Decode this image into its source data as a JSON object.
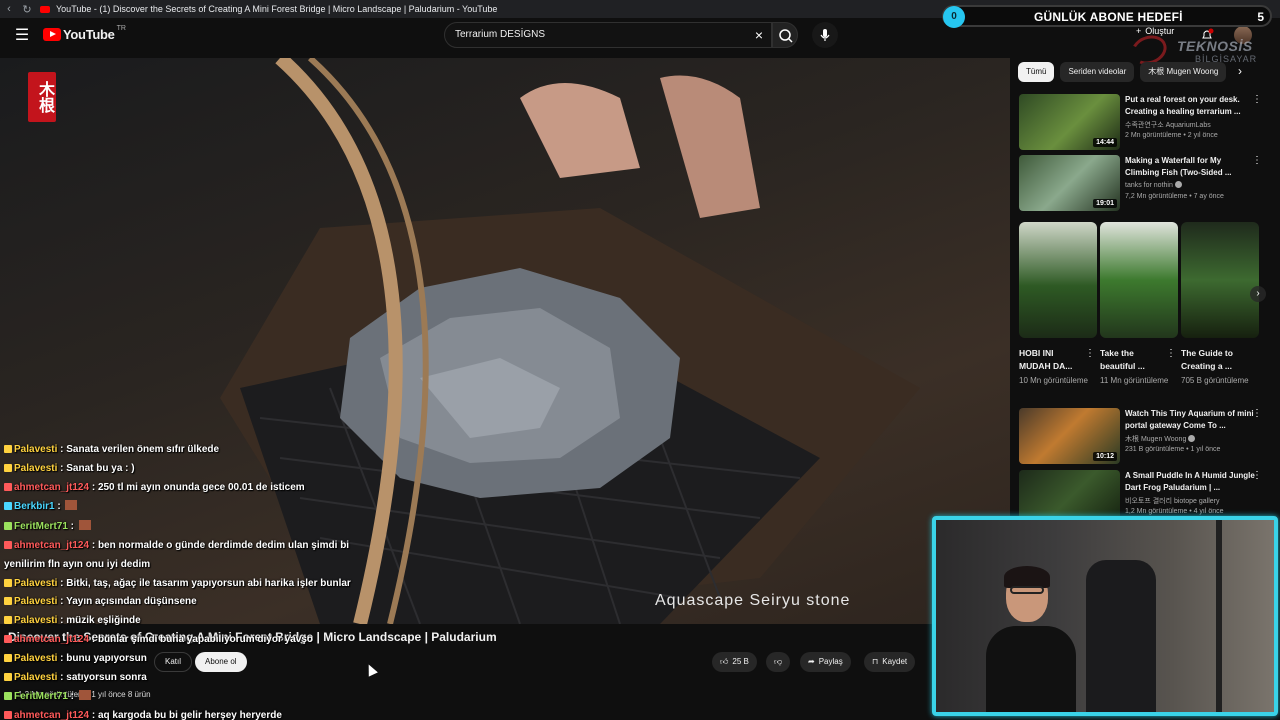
{
  "browser": {
    "tab_title": "YouTube - (1) Discover the Secrets of Creating A Mini Forest Bridge | Micro Landscape | Paludarium - YouTube"
  },
  "topbar": {
    "logo": "YouTube",
    "region": "TR",
    "search_query": "Terrarium DESİGNS",
    "create_label": "Oluştur"
  },
  "overlay": {
    "goal_left": "0",
    "goal_label": "GÜNLÜK ABONE HEDEFİ",
    "goal_right": "5",
    "sponsor_name": "TEKNOSİS",
    "sponsor_sub": "BİLGİSAYAR"
  },
  "video": {
    "stamp": "木根",
    "caption": "Aquascape Seiryu stone",
    "title": "Discover the Secrets of Creating A Mini Forest Bridge | Micro Landscape | Paludarium",
    "join_label": "Katıl",
    "subscribe_label": "Abone ol",
    "likes": "25 B",
    "share_label": "Paylaş",
    "save_label": "Kaydet",
    "meta": "1,2 Mn görüntüleme  1 yıl önce  8 ürün"
  },
  "chat": [
    {
      "user": "Palavesti",
      "color": "#ffd23f",
      "text": "Sanata verilen önem sıfır ülkede"
    },
    {
      "user": "Palavesti",
      "color": "#ffd23f",
      "text": "Sanat bu ya : )"
    },
    {
      "user": "ahmetcan_jt124",
      "color": "#ff5a5a",
      "text": "250 tl mi ayın onunda gece 00.01 de isticem"
    },
    {
      "user": "Berkbir1",
      "color": "#4ad7ff",
      "text": ""
    },
    {
      "user": "FeritMert71",
      "color": "#9be15d",
      "text": ""
    },
    {
      "user": "ahmetcan_jt124",
      "color": "#ff5a5a",
      "text": "ben normalde o günde derdimde dedim ulan şimdi bi"
    },
    {
      "user": "",
      "color": "#ffffff",
      "text": "yenilirim fln ayın onu iyi dedim"
    },
    {
      "user": "Palavesti",
      "color": "#ffd23f",
      "text": "Bitki, taş, ağaç ile tasarım yapıyorsun abi harika işler bunlar"
    },
    {
      "user": "Palavesti",
      "color": "#ffd23f",
      "text": "Yayın açısından düşünsene"
    },
    {
      "user": "Palavesti",
      "color": "#ffd23f",
      "text": "müzik eşliğinde"
    },
    {
      "user": "ahmetcan_jt124",
      "color": "#ff5a5a",
      "text": "bunlar şimdi buna yapabiliyorum diyor yavşo"
    },
    {
      "user": "Palavesti",
      "color": "#ffd23f",
      "text": "bunu yapıyorsun"
    },
    {
      "user": "Palavesti",
      "color": "#ffd23f",
      "text": "satıyorsun sonra"
    },
    {
      "user": "FeritMert71",
      "color": "#9be15d",
      "text": ""
    },
    {
      "user": "ahmetcan_jt124",
      "color": "#ff5a5a",
      "text": "aq kargoda bu bi gelir herşey heryerde"
    }
  ],
  "sidebar": {
    "chips": [
      "Tümü",
      "Seriden videolar",
      "木根 Mugen Woong"
    ],
    "recs": [
      {
        "title": "Put a real forest on your desk. Creating a healing terrarium ...",
        "channel": "수족관연구소 AquariumLabs",
        "meta": "2 Mn görüntüleme • 2 yıl önce",
        "duration": "14:44"
      },
      {
        "title": "Making a Waterfall for My Climbing Fish (Two-Sided ...",
        "channel": "tanks for nothin",
        "meta": "7,2 Mn görüntüleme • 7 ay önce",
        "duration": "19:01"
      },
      {
        "title": "Watch This Tiny Aquarium of mini portal gateway Come To ...",
        "channel": "木根 Mugen Woong",
        "meta": "231 B görüntüleme • 1 yıl önce",
        "duration": "10:12"
      },
      {
        "title": "A Small Puddle In A Humid Jungle Dart Frog Paludarium | ...",
        "channel": "비오토프 결러리 biotope gallery",
        "meta": "1,2 Mn görüntüleme • 4 yıl önce",
        "duration": ""
      }
    ],
    "shorts": [
      {
        "title": "HOBI INI MUDAH DA...",
        "views": "10 Mn görüntüleme"
      },
      {
        "title": "Take the beautiful ...",
        "views": "11 Mn görüntüleme"
      },
      {
        "title": "The Guide to Creating a ...",
        "views": "705 B görüntüleme"
      }
    ]
  }
}
